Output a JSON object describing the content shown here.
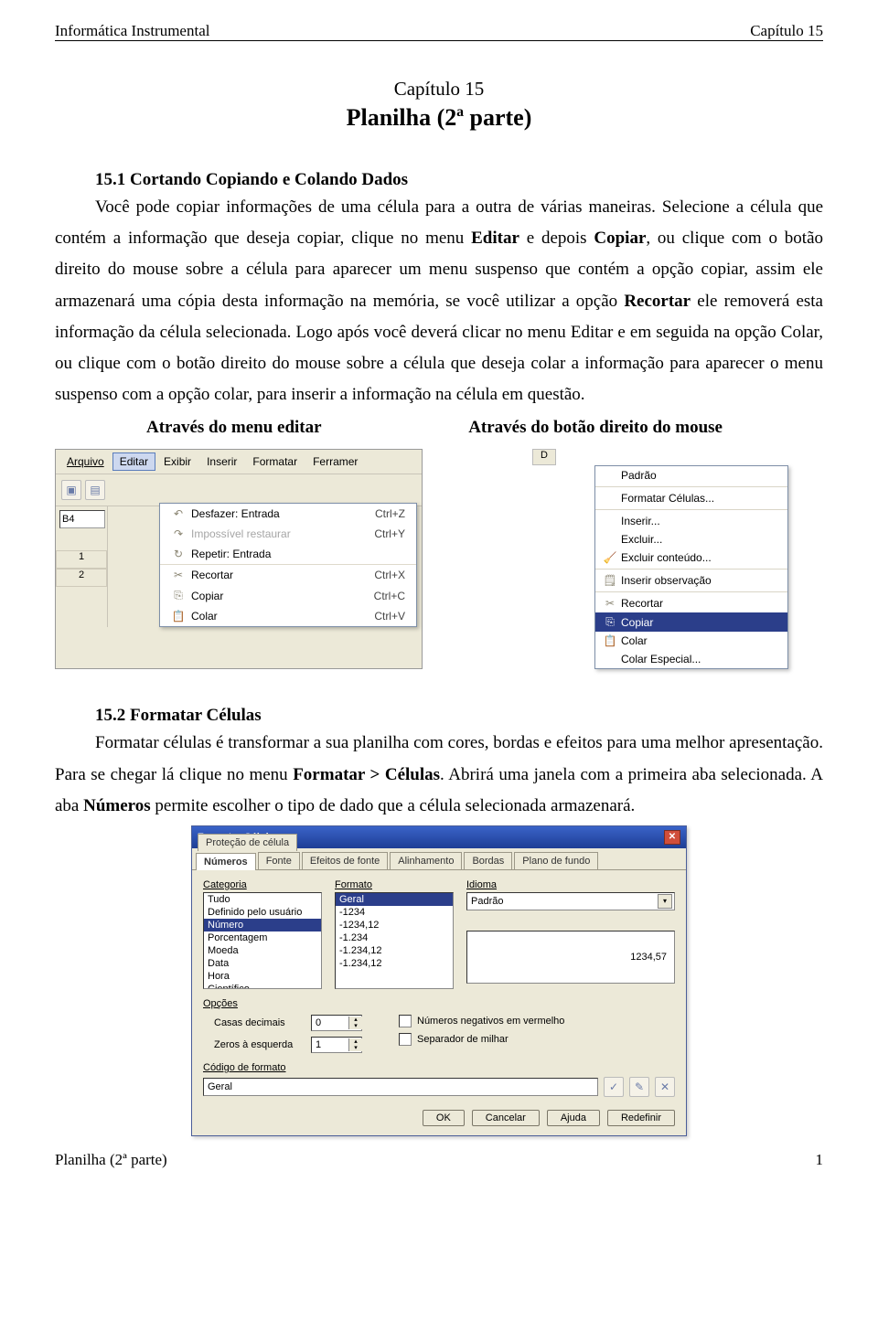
{
  "header": {
    "left": "Informática Instrumental",
    "right": "Capítulo 15"
  },
  "title": {
    "chapter": "Capítulo 15",
    "name": "Planilha (2ª parte)"
  },
  "sec1": {
    "head": "15.1 Cortando Copiando e Colando Dados",
    "p1a": "Você pode copiar informações de uma célula para a outra de várias maneiras. Selecione a célula que contém a informação que deseja copiar, clique no menu ",
    "p1b": "Editar",
    "p1c": " e depois ",
    "p1d": "Copiar",
    "p1e": ", ou clique com o botão direito do mouse sobre a célula para aparecer um menu suspenso que contém a opção copiar, assim ele armazenará uma cópia desta informação na memória, se você utilizar a opção ",
    "p1f": "Recortar",
    "p1g": " ele removerá esta informação da célula selecionada. Logo após você deverá clicar no menu Editar e em seguida na opção Colar, ou clique com o botão direito do mouse sobre a célula que deseja colar a informação para aparecer o menu suspenso com a opção colar, para inserir a informação na célula em questão.",
    "label_left": "Através do menu editar",
    "label_right": "Através do botão direito do mouse"
  },
  "editmenu": {
    "menubar": [
      "Arquivo",
      "Editar",
      "Exibir",
      "Inserir",
      "Formatar",
      "Ferramer"
    ],
    "cellref": "B4",
    "rows": [
      "1",
      "2"
    ],
    "items": [
      {
        "label": "Desfazer: Entrada",
        "sc": "Ctrl+Z",
        "dis": false,
        "u": "D"
      },
      {
        "label": "Impossível restaurar",
        "sc": "Ctrl+Y",
        "dis": true,
        "u": ""
      },
      {
        "label": "Repetir: Entrada",
        "sc": "",
        "dis": false,
        "u": "R",
        "sep": true
      },
      {
        "label": "Recortar",
        "sc": "Ctrl+X",
        "dis": false,
        "u": "t"
      },
      {
        "label": "Copiar",
        "sc": "Ctrl+C",
        "dis": false,
        "u": "C"
      },
      {
        "label": "Colar",
        "sc": "Ctrl+V",
        "dis": false,
        "u": "o"
      }
    ]
  },
  "ctxmenu": {
    "items": [
      {
        "label": "Padrão",
        "u": "P",
        "sep": true
      },
      {
        "label": "Formatar Células...",
        "u": "F",
        "sep": true
      },
      {
        "label": "Inserir...",
        "u": "I"
      },
      {
        "label": "Excluir...",
        "u": "l"
      },
      {
        "label": "Excluir conteúdo...",
        "u": "x",
        "sep": true
      },
      {
        "label": "Inserir observação",
        "u": "I",
        "sep": true
      },
      {
        "label": "Recortar",
        "u": "t"
      },
      {
        "label": "Copiar",
        "u": "C",
        "sel": true
      },
      {
        "label": "Colar",
        "u": "o"
      },
      {
        "label": "Colar Especial...",
        "u": "S"
      }
    ]
  },
  "sec2": {
    "head": "15.2 Formatar Células",
    "p_a": "Formatar células é transformar a sua planilha com cores, bordas e efeitos para uma melhor apresentação. Para se chegar lá clique no menu ",
    "p_b": "Formatar > Células",
    "p_c": ". Abrirá uma janela com a primeira aba selecionada. A aba ",
    "p_d": "Números",
    "p_e": " permite escolher o tipo de dado que a célula selecionada armazenará."
  },
  "dlg": {
    "title": "Formatar Células",
    "tabs": [
      "Números",
      "Fonte",
      "Efeitos de fonte",
      "Alinhamento",
      "Bordas",
      "Plano de fundo",
      "Proteção de célula"
    ],
    "cat_lbl": "Categoria",
    "categories": [
      "Tudo",
      "Definido pelo usuário",
      "Número",
      "Porcentagem",
      "Moeda",
      "Data",
      "Hora",
      "Científico"
    ],
    "fmt_lbl": "Formato",
    "formats": [
      "Geral",
      "-1234",
      "-1234,12",
      "-1.234",
      "-1.234,12",
      "-1.234,12"
    ],
    "lang_lbl": "Idioma",
    "lang_val": "Padrão",
    "preview": "1234,57",
    "opt_lbl": "Opções",
    "dec_lbl": "Casas decimais",
    "dec_val": "0",
    "zero_lbl": "Zeros à esquerda",
    "zero_val": "1",
    "neg_lbl": "Números negativos em vermelho",
    "sep_lbl": "Separador de milhar",
    "code_lbl": "Código de formato",
    "code_val": "Geral",
    "buttons": [
      "OK",
      "Cancelar",
      "Ajuda",
      "Redefinir"
    ]
  },
  "footer": {
    "left": "Planilha (2ª parte)",
    "right": "1"
  }
}
